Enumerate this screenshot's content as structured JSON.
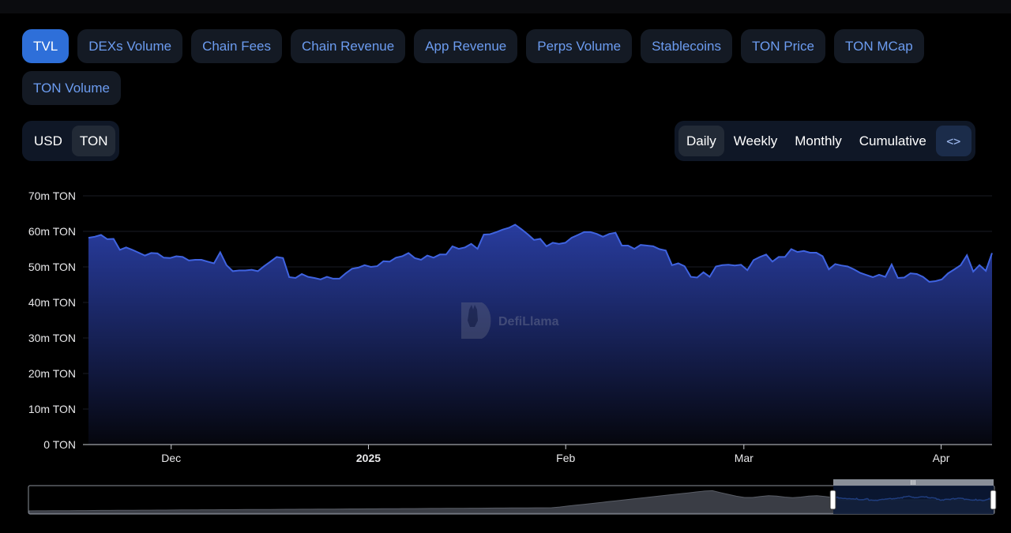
{
  "metric_tabs": [
    {
      "label": "TVL",
      "active": true
    },
    {
      "label": "DEXs Volume",
      "active": false
    },
    {
      "label": "Chain Fees",
      "active": false
    },
    {
      "label": "Chain Revenue",
      "active": false
    },
    {
      "label": "App Revenue",
      "active": false
    },
    {
      "label": "Perps Volume",
      "active": false
    },
    {
      "label": "Stablecoins",
      "active": false
    },
    {
      "label": "TON Price",
      "active": false
    },
    {
      "label": "TON MCap",
      "active": false
    },
    {
      "label": "TON Volume",
      "active": false
    }
  ],
  "unit_toggle": {
    "options": [
      "USD",
      "TON"
    ],
    "selected": "TON"
  },
  "period_toggle": {
    "options": [
      "Daily",
      "Weekly",
      "Monthly",
      "Cumulative"
    ],
    "selected": "Daily",
    "embed_icon": "code-brackets-icon"
  },
  "watermark": "DefiLlama",
  "colors": {
    "accent": "#2e6fd9",
    "line": "#3f63e0",
    "fill_top": "#2a3fa6",
    "tab_text": "#6c9cf0"
  },
  "chart_data": {
    "type": "area",
    "y_unit": "TON",
    "ylim": [
      0,
      70000000
    ],
    "y_ticks": [
      "0 TON",
      "10m TON",
      "20m TON",
      "30m TON",
      "40m TON",
      "50m TON",
      "60m TON",
      "70m TON"
    ],
    "x_range": [
      "2024-11-18",
      "2025-04-09"
    ],
    "x_ticks": [
      {
        "label": "Dec",
        "date": "2024-12-01",
        "bold": false
      },
      {
        "label": "2025",
        "date": "2025-01-01",
        "bold": true
      },
      {
        "label": "Feb",
        "date": "2025-02-01",
        "bold": false
      },
      {
        "label": "Mar",
        "date": "2025-03-01",
        "bold": false
      },
      {
        "label": "Apr",
        "date": "2025-04-01",
        "bold": false
      }
    ],
    "grid": true,
    "series": [
      {
        "values_millions": [
          58.2,
          58.5,
          59.0,
          57.8,
          57.9,
          54.8,
          55.5,
          54.8,
          54.0,
          53.2,
          53.9,
          53.8,
          52.6,
          52.5,
          53.0,
          52.8,
          51.8,
          52.0,
          52.0,
          51.5,
          51.0,
          54.1,
          50.5,
          48.8,
          49.0,
          49.0,
          49.2,
          48.8,
          50.2,
          51.5,
          52.8,
          52.5,
          47.1,
          46.9,
          48.0,
          47.2,
          46.9,
          46.5,
          47.2,
          46.7,
          46.7,
          48.2,
          49.5,
          49.8,
          50.5,
          50.0,
          50.2,
          51.6,
          51.5,
          52.6,
          53.0,
          53.9,
          52.5,
          52.0,
          53.2,
          52.6,
          53.5,
          53.5,
          55.8,
          55.1,
          55.5,
          56.5,
          55.1,
          59.1,
          59.2,
          59.8,
          60.5,
          61.0,
          61.9,
          60.6,
          59.2,
          57.6,
          57.9,
          55.8,
          56.8,
          56.5,
          56.8,
          58.2,
          59.0,
          59.8,
          59.8,
          59.3,
          58.5,
          59.3,
          59.6,
          56.0,
          56.0,
          55.1,
          56.2,
          56.0,
          55.8,
          55.0,
          54.6,
          50.5,
          51.0,
          50.2,
          47.2,
          47.0,
          48.5,
          47.2,
          50.1,
          50.5,
          50.6,
          50.4,
          50.6,
          49.1,
          51.9,
          52.8,
          53.5,
          51.5,
          52.8,
          52.8,
          55.0,
          54.2,
          54.5,
          54.0,
          54.0,
          53.0,
          49.3,
          50.8,
          50.4,
          50.1,
          49.3,
          48.3,
          47.7,
          47.1,
          47.8,
          47.2,
          50.7,
          46.9,
          47.0,
          48.2,
          48.0,
          47.2,
          45.8,
          46.0,
          46.5,
          48.2,
          49.3,
          50.5,
          53.3,
          48.7,
          50.5,
          48.9,
          53.9
        ]
      }
    ]
  }
}
